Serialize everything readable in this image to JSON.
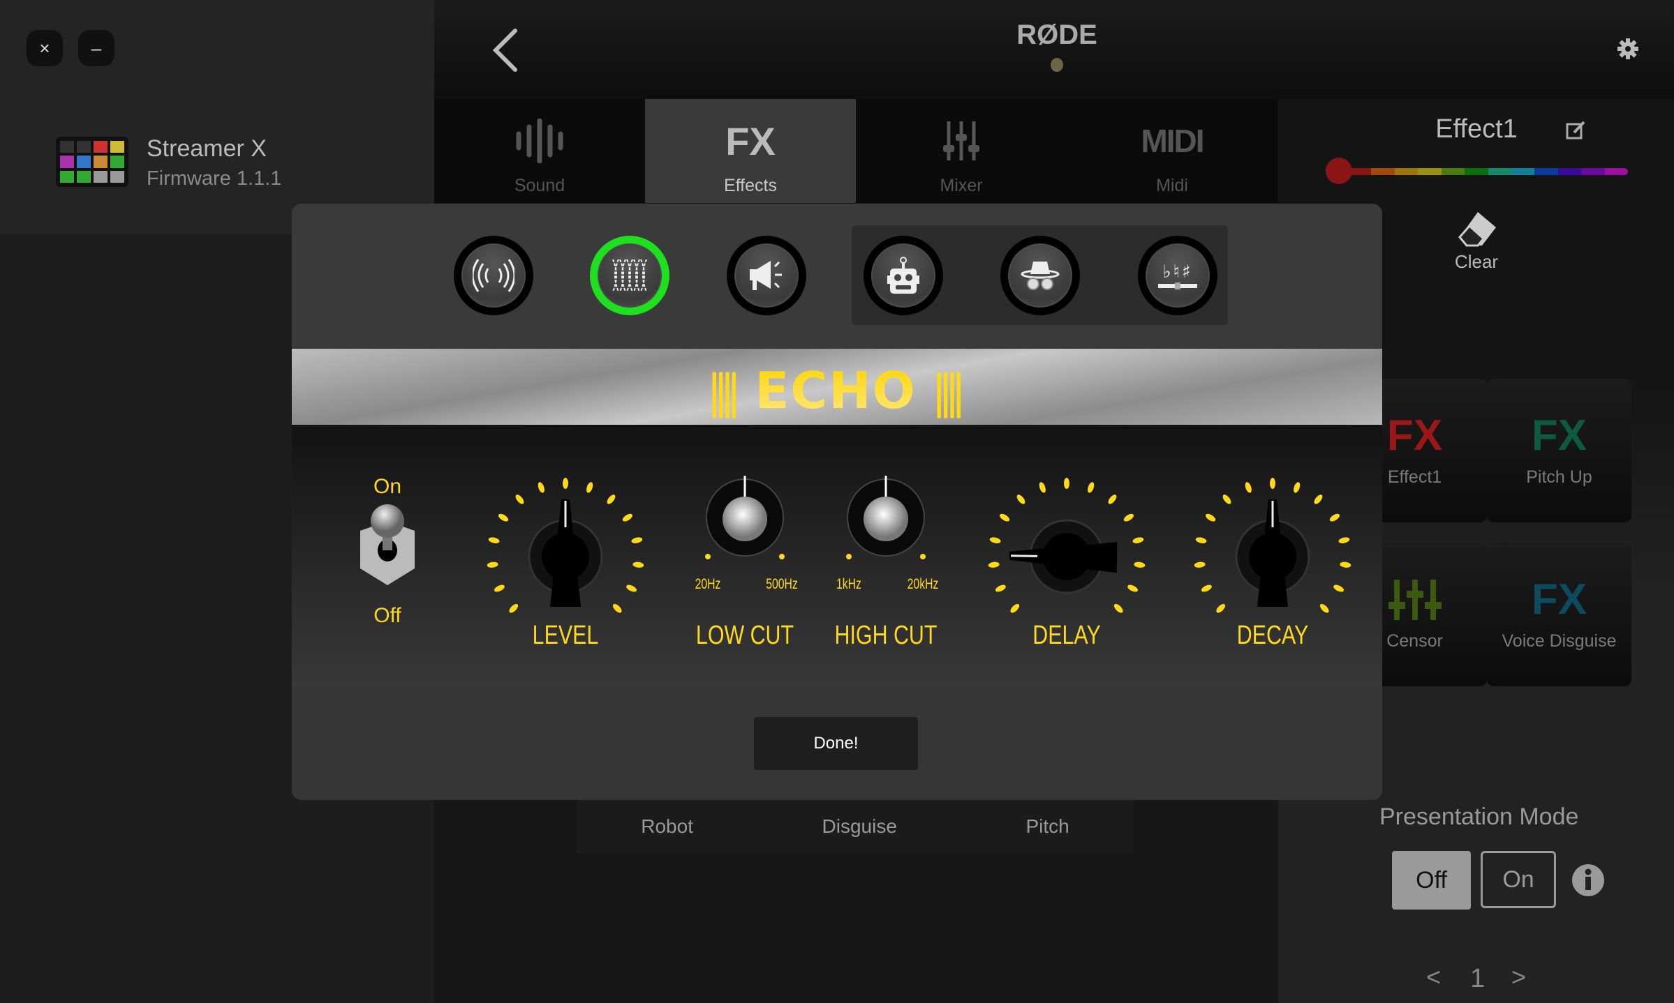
{
  "window": {
    "close_label": "×",
    "minimize_label": "–"
  },
  "device": {
    "name": "Streamer X",
    "firmware": "Firmware 1.1.1"
  },
  "header": {
    "logo": "RØDE"
  },
  "tabs": [
    {
      "label": "Sound",
      "icon": "waveform-icon"
    },
    {
      "label": "Effects",
      "icon": "fx-icon",
      "fx": "FX",
      "active": true
    },
    {
      "label": "Mixer",
      "icon": "sliders-icon"
    },
    {
      "label": "Midi",
      "icon": "midi-icon",
      "glyph": "MIDI"
    }
  ],
  "right_panel": {
    "title": "Effect1",
    "clear_label": "Clear",
    "color_palette": [
      "#8b1414",
      "#a04a0a",
      "#a0720a",
      "#9a9010",
      "#4a7a10",
      "#0c6e0c",
      "#108a6a",
      "#10809a",
      "#0a3aa0",
      "#3a0aa0",
      "#6a0aa0",
      "#a010a0"
    ],
    "selected_color": "#8b1414",
    "tiles": [
      {
        "fx": "FX",
        "label": "Effect1",
        "color": "#9a1818"
      },
      {
        "fx": "FX",
        "label": "Pitch Up",
        "color": "#0e5a3e"
      },
      {
        "fx": "",
        "label": "Censor",
        "color": "#3a5a10"
      },
      {
        "fx": "FX",
        "label": "Voice Disguise",
        "color": "#0e4a5e"
      }
    ],
    "presentation_mode": {
      "label": "Presentation Mode",
      "off": "Off",
      "on": "On",
      "value": "Off"
    },
    "pager": {
      "prev": "<",
      "page": "1",
      "next": ">"
    }
  },
  "background_tabs": [
    "Robot",
    "Disguise",
    "Pitch"
  ],
  "modal": {
    "effects": [
      {
        "name": "reverb",
        "icon": "reverb-icon"
      },
      {
        "name": "echo",
        "icon": "echo-icon",
        "selected": true
      },
      {
        "name": "megaphone",
        "icon": "megaphone-icon"
      },
      {
        "name": "robot",
        "icon": "robot-icon"
      },
      {
        "name": "disguise",
        "icon": "disguise-icon"
      },
      {
        "name": "pitch",
        "icon": "pitch-icon",
        "glyph": "♭♮♯"
      }
    ],
    "title": "ECHO",
    "title_bars": "||||",
    "toggle": {
      "on_label": "On",
      "off_label": "Off",
      "value": "On"
    },
    "knobs": [
      {
        "id": "level",
        "label": "LEVEL",
        "type": "pointer",
        "value": 0.5
      },
      {
        "id": "low-cut",
        "label": "LOW CUT",
        "type": "metal",
        "value": 0.5,
        "min_label": "20Hz",
        "max_label": "500Hz"
      },
      {
        "id": "high-cut",
        "label": "HIGH CUT",
        "type": "metal",
        "value": 0.5,
        "min_label": "1kHz",
        "max_label": "20kHz"
      },
      {
        "id": "delay",
        "label": "DELAY",
        "type": "pointer",
        "value": 0.17
      },
      {
        "id": "decay",
        "label": "DECAY",
        "type": "pointer",
        "value": 0.5
      }
    ],
    "accent": "#ffd91a",
    "selected_ring": "#1ee01e",
    "done_label": "Done!"
  }
}
